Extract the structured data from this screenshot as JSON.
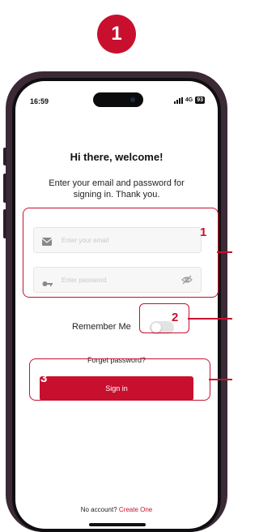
{
  "step_badge": "1",
  "status_bar": {
    "time": "16:59",
    "network": "4G",
    "battery": "93"
  },
  "login": {
    "title": "Hi there, welcome!",
    "subtitle": "Enter your email and password for signing in. Thank you.",
    "email_placeholder": "Enter your email",
    "password_placeholder": "Enter password",
    "remember_label": "Remember Me",
    "remember_on": false,
    "forget_label": "Forget password?",
    "signin_label": "Sign in",
    "no_account_label": "No account?",
    "create_label": "Create One"
  },
  "callouts": {
    "fields": "1",
    "remember": "2",
    "signin": "3"
  },
  "colors": {
    "accent": "#c8102e",
    "frame": "#3b2a35"
  },
  "icons": [
    "envelope-icon",
    "key-icon",
    "eye-off-icon"
  ]
}
